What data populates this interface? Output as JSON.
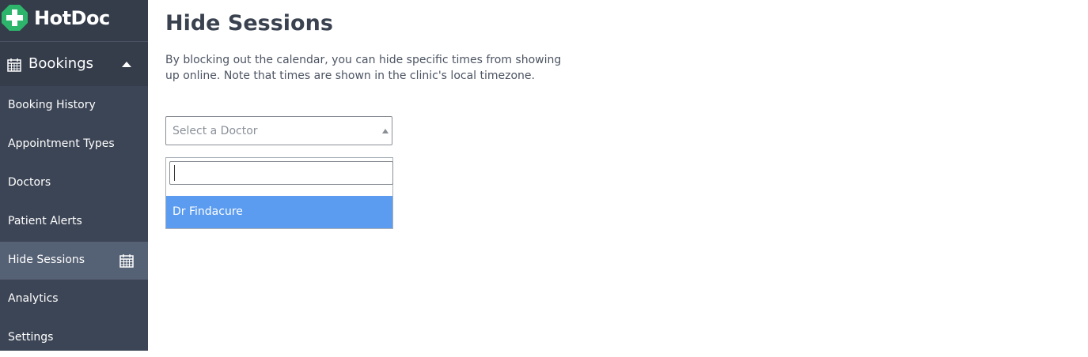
{
  "brand": {
    "name": "HotDoc",
    "logo_icon": "cross-logo-icon",
    "accent": "#2db56b"
  },
  "sidebar": {
    "section": {
      "label": "Bookings",
      "icon": "calendar-icon"
    },
    "items": [
      {
        "label": "Booking History"
      },
      {
        "label": "Appointment Types"
      },
      {
        "label": "Doctors"
      },
      {
        "label": "Patient Alerts"
      },
      {
        "label": "Hide Sessions",
        "active": true,
        "icon": "calendar-icon"
      },
      {
        "label": "Analytics"
      },
      {
        "label": "Settings"
      }
    ]
  },
  "main": {
    "title": "Hide Sessions",
    "description": "By blocking out the calendar, you can hide specific times from showing up online. Note that times are shown in the clinic's local timezone.",
    "doctor_select": {
      "placeholder": "Select a Doctor",
      "search_value": "",
      "options": [
        {
          "label": "Dr Findacure",
          "highlighted": true
        }
      ]
    }
  },
  "colors": {
    "sidebar_bg": "#3c4555",
    "sidebar_active": "#556174",
    "option_highlight": "#5b9cf0"
  }
}
